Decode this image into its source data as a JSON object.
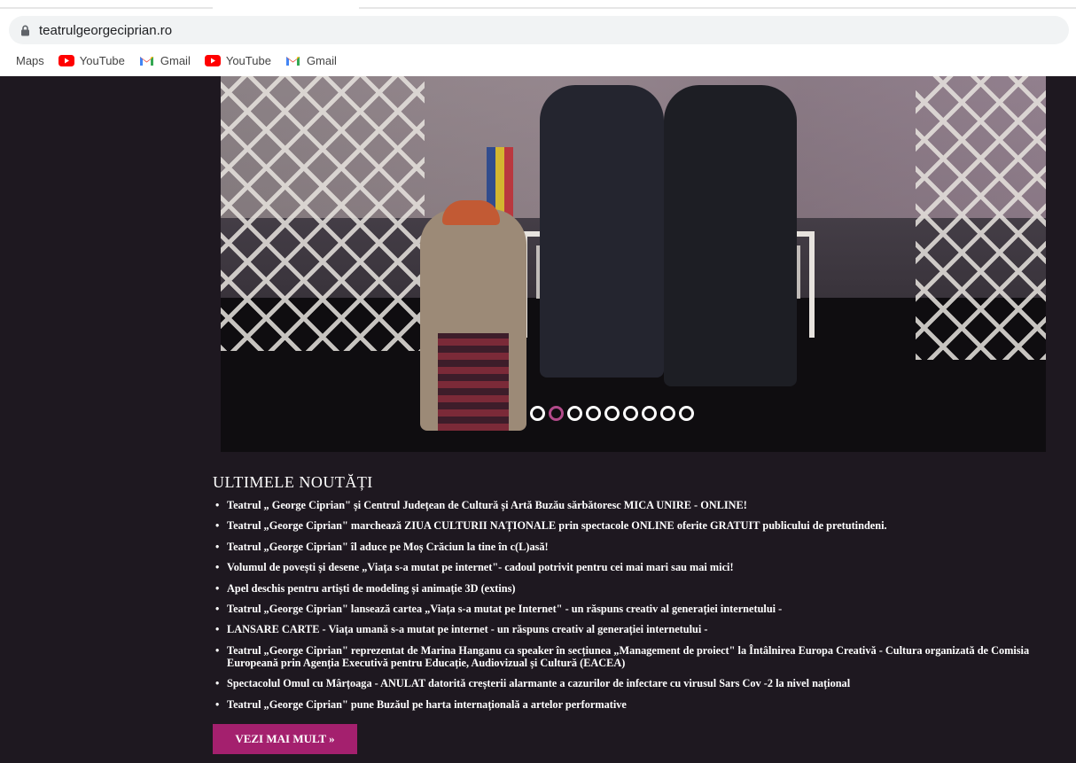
{
  "browser": {
    "url": "teatrulgeorgeciprian.ro",
    "bookmarks": [
      {
        "label": "Maps",
        "icon": "none"
      },
      {
        "label": "YouTube",
        "icon": "youtube-icon"
      },
      {
        "label": "Gmail",
        "icon": "gmail-icon"
      },
      {
        "label": "YouTube",
        "icon": "youtube-icon"
      },
      {
        "label": "Gmail",
        "icon": "gmail-icon"
      }
    ]
  },
  "carousel": {
    "slide_count": 9,
    "active_index": 1
  },
  "news": {
    "title": "ULTIMELE NOUTĂȚI",
    "items": [
      "Teatrul „ George Ciprian\" și Centrul Județean de Cultură și Artă Buzău sărbătoresc MICA UNIRE - ONLINE!",
      "Teatrul „George Ciprian\" marchează ZIUA CULTURII NAȚIONALE prin spectacole ONLINE oferite GRATUIT publicului de pretutindeni.",
      "Teatrul „George Ciprian\" îl aduce pe Moș Crăciun la tine în c(L)asă!",
      "Volumul de povești și desene „Viața s-a mutat pe internet\"- cadoul potrivit pentru cei mai mari sau mai mici!",
      "Apel deschis pentru artiști de modeling și animație 3D (extins)",
      "Teatrul „George Ciprian\" lansează cartea „Viața s-a mutat pe Internet\" - un răspuns creativ al generației internetului -",
      "LANSARE CARTE - Viața umană s-a mutat pe internet - un răspuns creativ al generației internetului -",
      "Teatrul „George Ciprian\" reprezentat de Marina Hanganu ca speaker în secțiunea „Management de proiect\" la Întâlnirea Europa Creativă - Cultura organizată de Comisia Europeană prin Agenția Executivă pentru Educație, Audiovizual și Cultură (EACEA)",
      "Spectacolul Omul cu Mârțoaga - ANULAT datorită creșterii alarmante a cazurilor de infectare cu virusul Sars Cov -2 la nivel național",
      "Teatrul „George Ciprian\" pune Buzăul pe harta internațională a artelor performative"
    ],
    "more_button": "VEZI MAI MULT »"
  },
  "colors": {
    "page_bg": "#1e1820",
    "accent": "#a4206e",
    "dot_active": "#b24a8a"
  }
}
